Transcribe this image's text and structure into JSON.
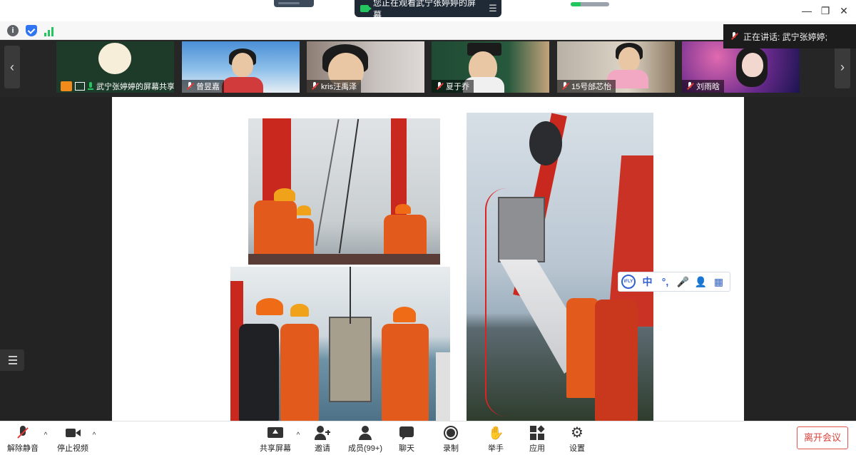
{
  "top_banner": {
    "viewing_text": "您正在观看武宁张婷婷的屏幕",
    "menu_glyph": "☰"
  },
  "window_controls": {
    "minimize": "—",
    "restore": "❐",
    "close": "✕"
  },
  "toolrow_icons": [
    "info-icon",
    "shield-icon",
    "signal-icon"
  ],
  "speaking": {
    "text": "正在讲话: 武宁张婷婷;"
  },
  "participants": [
    {
      "name": "武宁张婷婷的屏幕共享",
      "mic": "on"
    },
    {
      "name": "曾昱嘉",
      "mic": "muted"
    },
    {
      "name": "kris汪禹泽",
      "mic": "muted"
    },
    {
      "name": "夏于乔",
      "mic": "muted"
    },
    {
      "name": "15号邰芯怡",
      "mic": "muted"
    },
    {
      "name": "刘雨晗",
      "mic": "muted"
    }
  ],
  "strip_nav": {
    "prev": "‹",
    "next": "›",
    "collapse": "︿"
  },
  "ifly_toolbar": {
    "logo": "iFLY",
    "chinese": "中",
    "punct": "°,",
    "voice": "🎤",
    "user": "👤",
    "apps": "▦"
  },
  "bottom_bar": {
    "unmute": "解除静音",
    "stop_video": "停止视频",
    "share_screen": "共享屏幕",
    "invite": "邀请",
    "members": "成员(99+)",
    "chat": "聊天",
    "record": "录制",
    "raise_hand": "举手",
    "apps": "应用",
    "settings": "设置",
    "leave": "离开会议",
    "caret": "^"
  },
  "colors": {
    "accent_green": "#22c55e",
    "leave_red": "#d9433c",
    "ifly_blue": "#2f5fd0"
  }
}
